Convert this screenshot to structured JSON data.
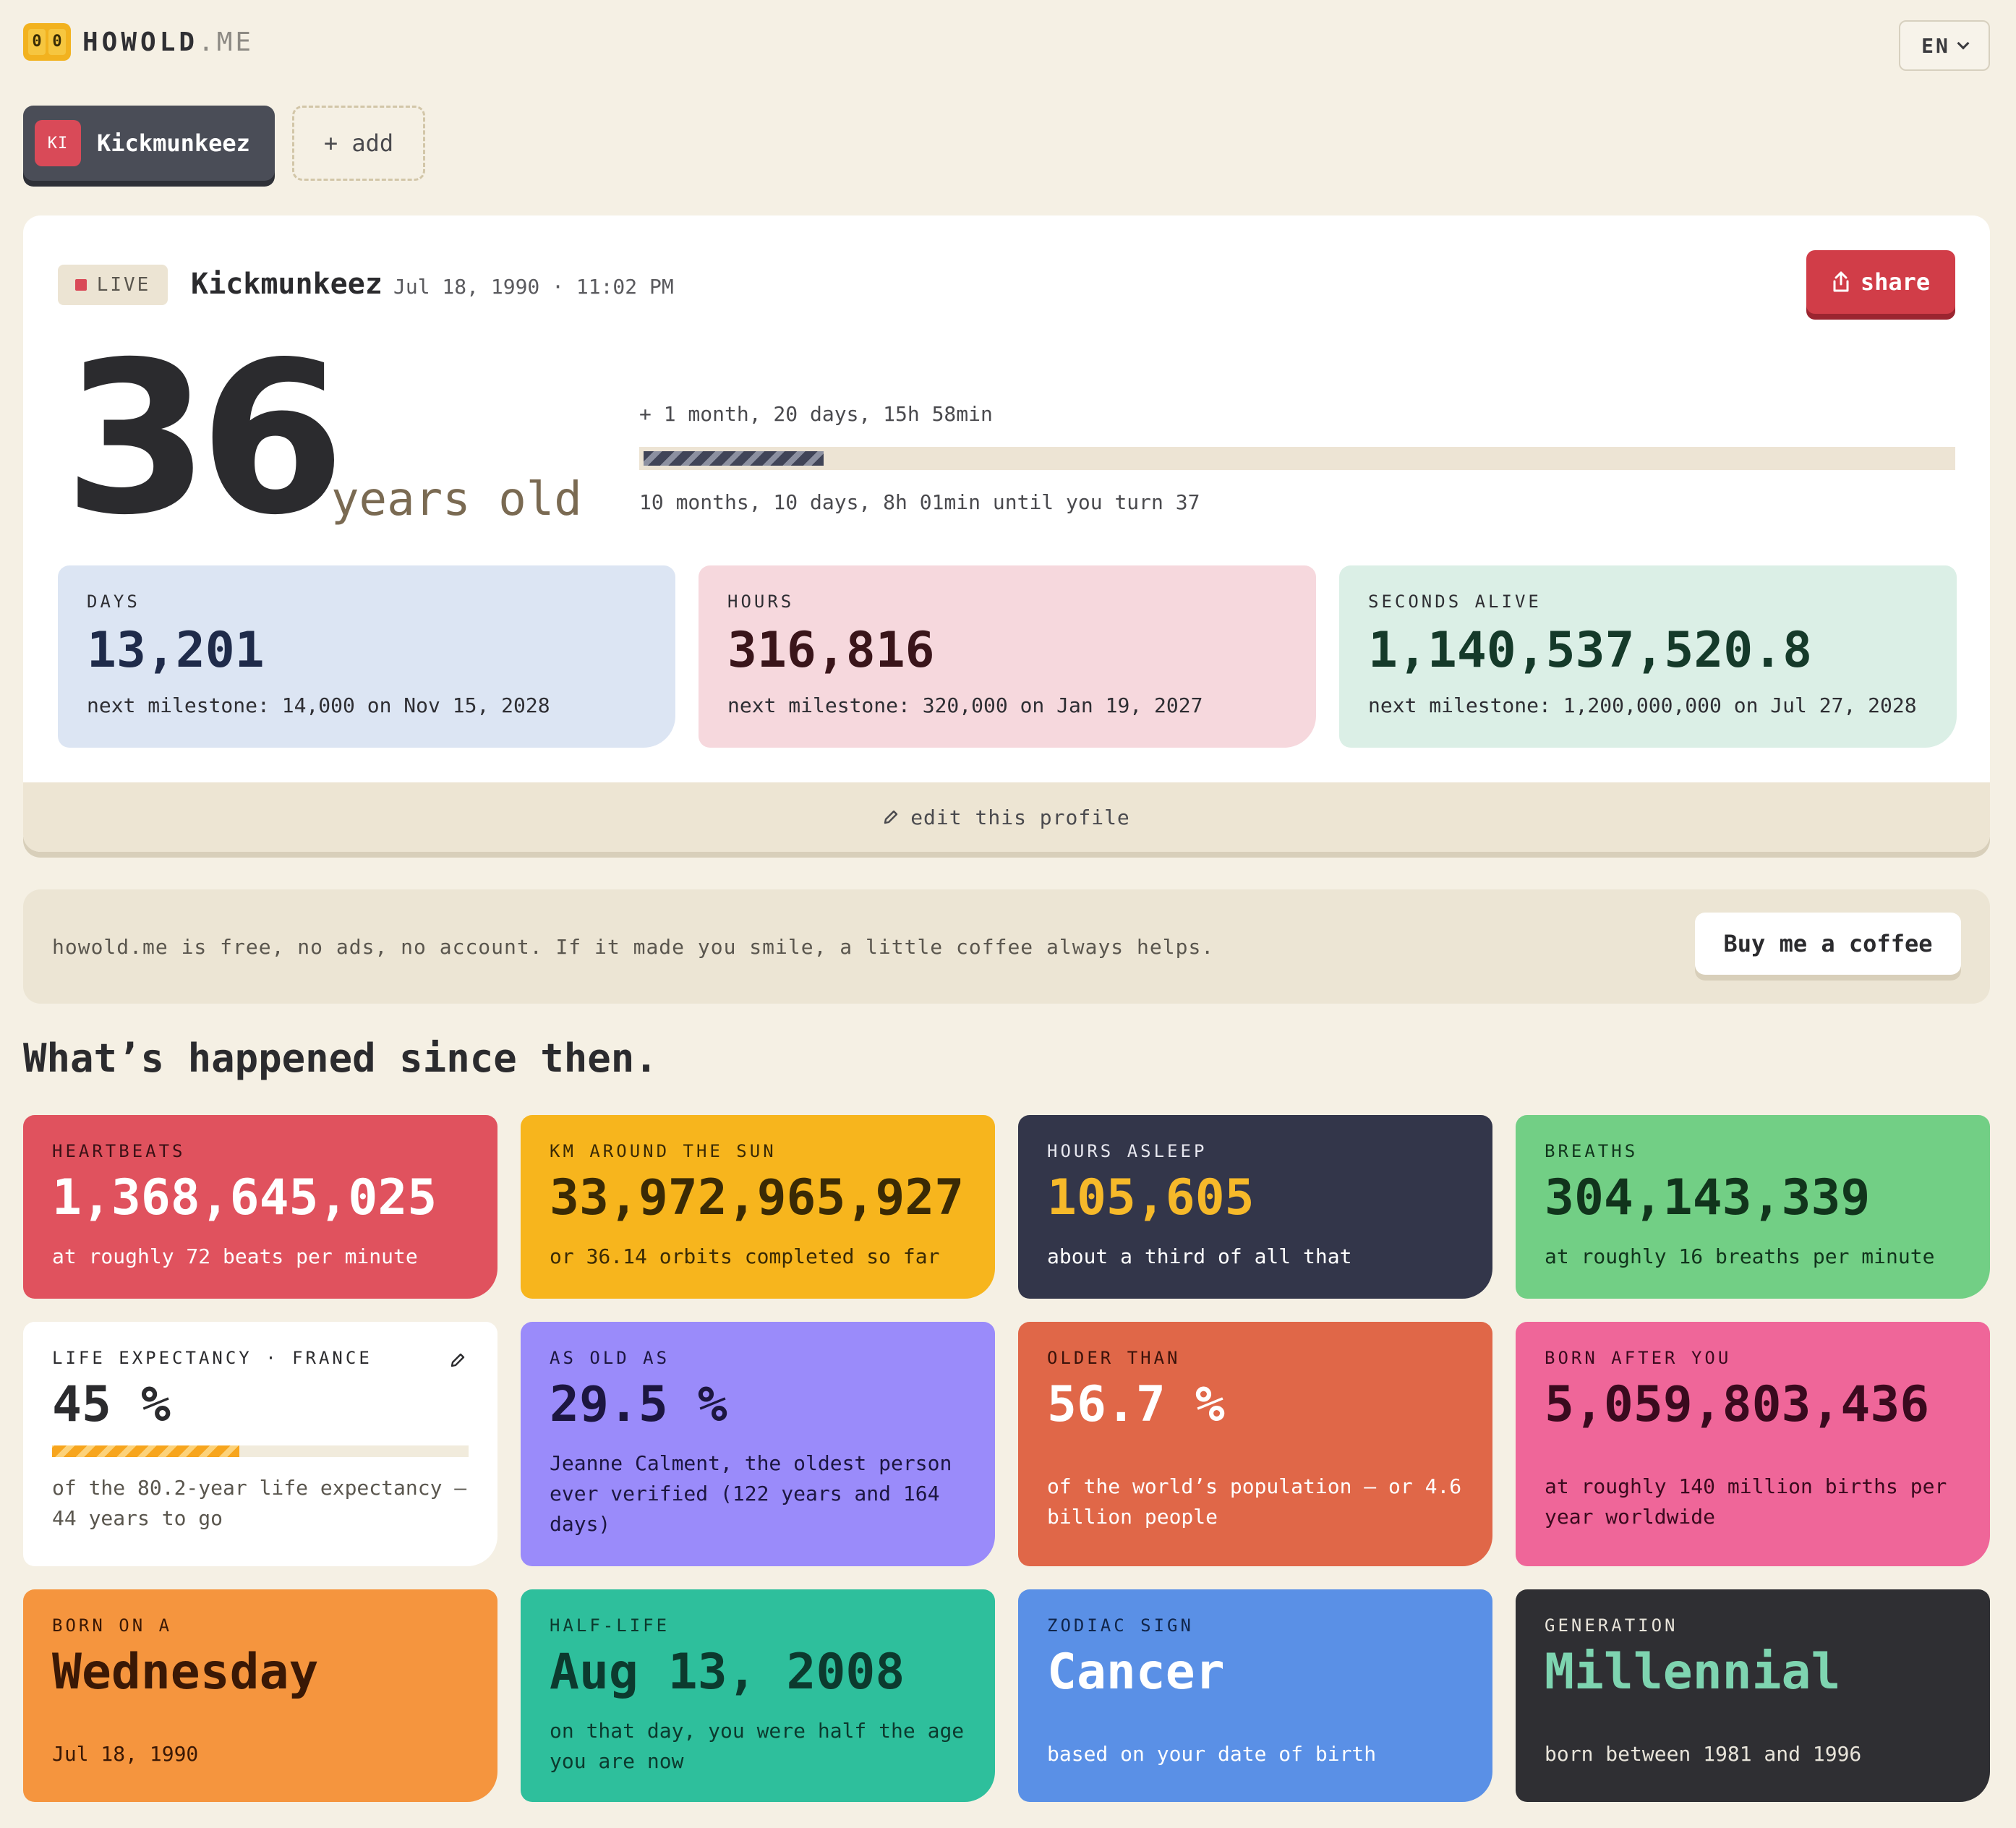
{
  "header": {
    "logo_digits": [
      "0",
      "0"
    ],
    "logo_name": "HOWOLD",
    "logo_tld": ".ME",
    "language": "EN"
  },
  "profiles": {
    "active": {
      "initials": "KI",
      "name": "Kickmunkeez"
    },
    "add_label": "+ add"
  },
  "card": {
    "live_label": "LIVE",
    "name": "Kickmunkeez",
    "birth": "Jul 18, 1990 · 11:02 PM",
    "share_label": "share",
    "age": "36",
    "age_unit": "years old",
    "since_birthday": "+ 1 month, 20 days, 15h 58min",
    "year_progress": 0.14,
    "until_next": "10 months, 10 days, 8h 01min until you turn 37",
    "stats": [
      {
        "label": "DAYS",
        "value": "13,201",
        "sub": "next milestone: 14,000 on Nov 15, 2028"
      },
      {
        "label": "HOURS",
        "value": "316,816",
        "sub": "next milestone: 320,000 on Jan 19, 2027"
      },
      {
        "label": "SECONDS ALIVE",
        "value": "1,140,537,520.8",
        "sub": "next milestone: 1,200,000,000 on Jul 27, 2028"
      }
    ],
    "edit_label": "edit this profile"
  },
  "coffee": {
    "text": "howold.me is free, no ads, no account. If it made you smile, a little coffee always helps.",
    "button": "Buy me a coffee"
  },
  "section_title": "What’s happened since then.",
  "tiles": [
    {
      "label": "HEARTBEATS",
      "value": "1,368,645,025",
      "sub": "at roughly 72 beats per minute",
      "color": "#e0525e"
    },
    {
      "label": "KM AROUND THE SUN",
      "value": "33,972,965,927",
      "sub": "or 36.14 orbits completed so far",
      "color": "#f7b51d"
    },
    {
      "label": "HOURS ASLEEP",
      "value": "105,605",
      "sub": "about a third of all that",
      "color": "#33364a"
    },
    {
      "label": "BREATHS",
      "value": "304,143,339",
      "sub": "at roughly 16 breaths per minute",
      "color": "#72cf85"
    },
    {
      "label": "LIFE EXPECTANCY · FRANCE",
      "value": "45 %",
      "progress": 0.45,
      "sub": "of the 80.2-year life expectancy — 44 years to go",
      "color": "#ffffff"
    },
    {
      "label": "AS OLD AS",
      "value": "29.5 %",
      "sub": "Jeanne Calment, the oldest person ever verified (122 years and 164 days)",
      "color": "#9a8bfa"
    },
    {
      "label": "OLDER THAN",
      "value": "56.7 %",
      "sub": "of the world’s population — or 4.6 billion people",
      "color": "#e06748"
    },
    {
      "label": "BORN AFTER YOU",
      "value": "5,059,803,436",
      "sub": "at roughly 140 million births per year worldwide",
      "color": "#ef6699"
    },
    {
      "label": "BORN ON A",
      "value": "Wednesday",
      "sub": "Jul 18, 1990",
      "color": "#f5953e"
    },
    {
      "label": "HALF-LIFE",
      "value": "Aug 13, 2008",
      "sub": "on that day, you were half the age you are now",
      "color": "#2ebf9c"
    },
    {
      "label": "ZODIAC SIGN",
      "value": "Cancer",
      "sub": "based on your date of birth",
      "color": "#5a90e6"
    },
    {
      "label": "GENERATION",
      "value": "Millennial",
      "sub": "born between 1981 and 1996",
      "color": "#2f2f33"
    }
  ]
}
